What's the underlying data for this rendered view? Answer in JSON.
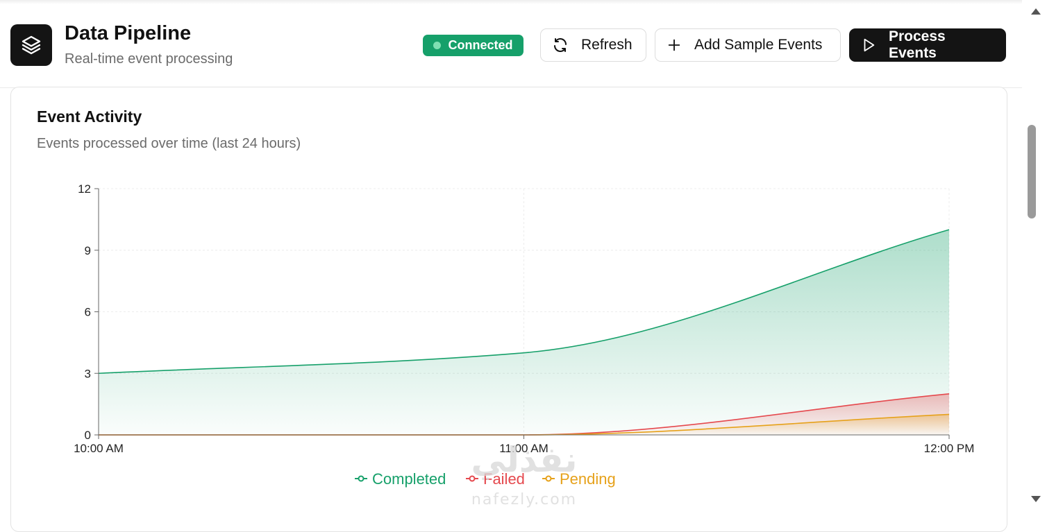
{
  "header": {
    "title": "Data Pipeline",
    "subtitle": "Real-time event processing",
    "logo_icon": "layers-icon",
    "status": "Connected",
    "status_color": "#16a06a",
    "buttons": {
      "refresh": "Refresh",
      "add_sample": "Add Sample Events",
      "process": "Process Events"
    }
  },
  "card": {
    "title": "Event Activity",
    "subtitle": "Events processed over time (last 24 hours)"
  },
  "chart_data": {
    "type": "area",
    "x": [
      "10:00 AM",
      "11:00 AM",
      "12:00 PM"
    ],
    "series": [
      {
        "name": "Completed",
        "values": [
          3,
          4,
          10
        ],
        "color": "#16a06a"
      },
      {
        "name": "Failed",
        "values": [
          0,
          0,
          2
        ],
        "color": "#e5484d"
      },
      {
        "name": "Pending",
        "values": [
          0,
          0,
          1
        ],
        "color": "#e6a11a"
      }
    ],
    "ylim": [
      0,
      12
    ],
    "yticks": [
      0,
      3,
      6,
      9,
      12
    ],
    "grid": true,
    "legend": "bottom"
  },
  "watermark": {
    "arabic": "نفذلي",
    "latin": "nafezly.com"
  }
}
